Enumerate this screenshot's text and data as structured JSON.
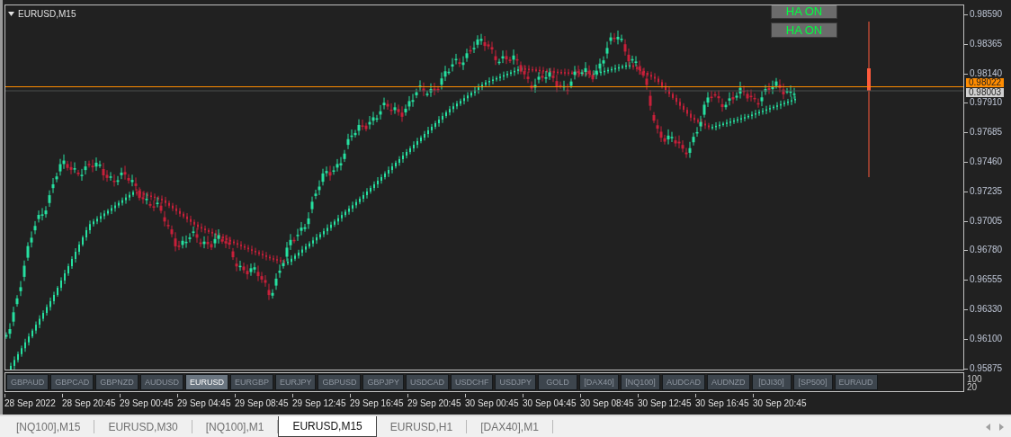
{
  "chart": {
    "title": "EURUSD,M15",
    "indicator_buttons": [
      "HA ON",
      "HA ON"
    ],
    "price_axis": [
      "0.98590",
      "0.98365",
      "0.98140",
      "0.97910",
      "0.97685",
      "0.97460",
      "0.97235",
      "0.97005",
      "0.96780",
      "0.96555",
      "0.96330",
      "0.96100",
      "0.95875"
    ],
    "ask_label": "0.98022",
    "bid_label": "0.98003",
    "time_axis": [
      "28 Sep 2022",
      "28 Sep 20:45",
      "29 Sep 00:45",
      "29 Sep 04:45",
      "29 Sep 08:45",
      "29 Sep 12:45",
      "29 Sep 16:45",
      "29 Sep 20:45",
      "30 Sep 00:45",
      "30 Sep 04:45",
      "30 Sep 08:45",
      "30 Sep 12:45",
      "30 Sep 16:45",
      "30 Sep 20:45"
    ]
  },
  "symbol_buttons": [
    {
      "label": "GBPAUD",
      "selected": false
    },
    {
      "label": "GBPCAD",
      "selected": false
    },
    {
      "label": "GBPNZD",
      "selected": false
    },
    {
      "label": "AUDUSD",
      "selected": false
    },
    {
      "label": "EURUSD",
      "selected": true
    },
    {
      "label": "EURGBP",
      "selected": false
    },
    {
      "label": "EURJPY",
      "selected": false
    },
    {
      "label": "GBPUSD",
      "selected": false
    },
    {
      "label": "GBPJPY",
      "selected": false
    },
    {
      "label": "USDCAD",
      "selected": false
    },
    {
      "label": "USDCHF",
      "selected": false
    },
    {
      "label": "USDJPY",
      "selected": false
    },
    {
      "label": "GOLD",
      "selected": false
    },
    {
      "label": "[DAX40]",
      "selected": false
    },
    {
      "label": "[NQ100]",
      "selected": false
    },
    {
      "label": "AUDCAD",
      "selected": false
    },
    {
      "label": "AUDNZD",
      "selected": false
    },
    {
      "label": "[DJI30]",
      "selected": false
    },
    {
      "label": "[SP500]",
      "selected": false
    },
    {
      "label": "EURAUD",
      "selected": false
    }
  ],
  "subwindow_scale": [
    "100",
    "20"
  ],
  "tabs": [
    {
      "label": "[NQ100],M15",
      "selected": false
    },
    {
      "label": "EURUSD,M30",
      "selected": false
    },
    {
      "label": "[NQ100],M1",
      "selected": false
    },
    {
      "label": "EURUSD,M15",
      "selected": true
    },
    {
      "label": "EURUSD,H1",
      "selected": false
    },
    {
      "label": "[DAX40],M1",
      "selected": false
    }
  ]
}
